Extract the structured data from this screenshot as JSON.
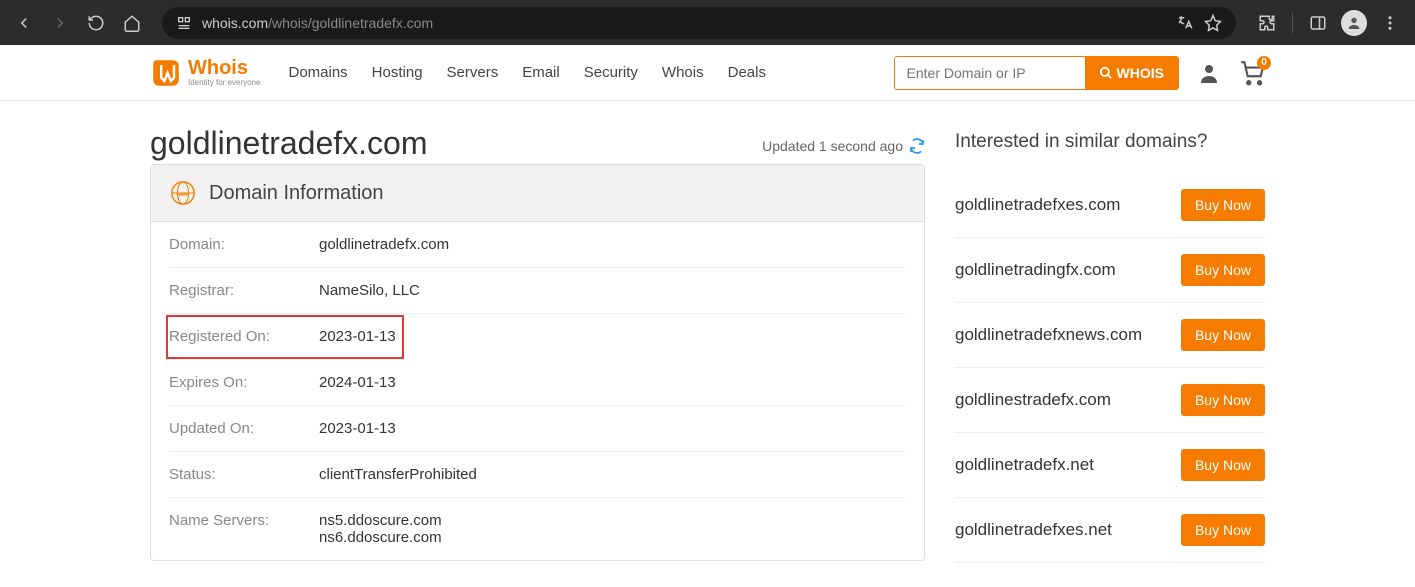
{
  "browser": {
    "url_host": "whois.com",
    "url_path": "/whois/goldlinetradefx.com"
  },
  "header": {
    "logo_main": "Whois",
    "logo_sub": "Identity for everyone",
    "nav": [
      "Domains",
      "Hosting",
      "Servers",
      "Email",
      "Security",
      "Whois",
      "Deals"
    ],
    "search_placeholder": "Enter Domain or IP",
    "search_button": "WHOIS",
    "cart_count": "0"
  },
  "page": {
    "title": "goldlinetradefx.com",
    "updated_text": "Updated 1 second ago",
    "card_title": "Domain Information",
    "domain_info": {
      "domain_label": "Domain:",
      "domain_value": "goldlinetradefx.com",
      "registrar_label": "Registrar:",
      "registrar_value": "NameSilo, LLC",
      "registered_label": "Registered On:",
      "registered_value": "2023-01-13",
      "expires_label": "Expires On:",
      "expires_value": "2024-01-13",
      "updated_label": "Updated On:",
      "updated_value": "2023-01-13",
      "status_label": "Status:",
      "status_value": "clientTransferProhibited",
      "nameservers_label": "Name Servers:",
      "nameservers_value1": "ns5.ddoscure.com",
      "nameservers_value2": "ns6.ddoscure.com"
    }
  },
  "sidebar": {
    "title": "Interested in similar domains?",
    "buy_label": "Buy Now",
    "similar": [
      "goldlinetradefxes.com",
      "goldlinetradingfx.com",
      "goldlinetradefxnews.com",
      "goldlinestradefx.com",
      "goldlinetradefx.net",
      "goldlinetradefxes.net"
    ]
  }
}
